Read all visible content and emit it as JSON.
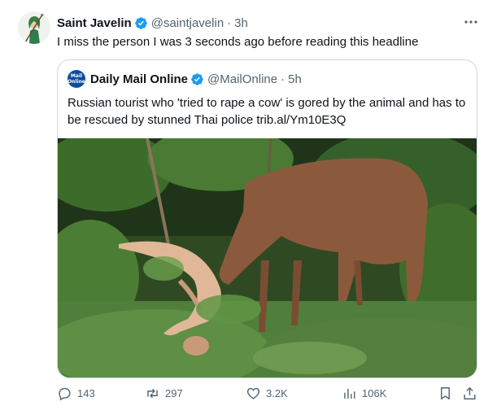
{
  "tweet": {
    "author_name": "Saint Javelin",
    "handle": "@saintjavelin",
    "separator": "·",
    "time": "3h",
    "text": "I miss the person I was 3 seconds ago before reading this headline"
  },
  "quote": {
    "avatar_text_1": "Mail",
    "avatar_text_2": "Online",
    "author_name": "Daily Mail Online",
    "handle": "@MailOnline",
    "separator": "·",
    "time": "5h",
    "text": "Russian tourist who 'tried to rape a cow' is gored by the animal and has to be rescued by stunned Thai police trib.al/Ym10E3Q"
  },
  "actions": {
    "replies": "143",
    "reposts": "297",
    "likes": "3.2K",
    "views": "106K"
  },
  "icons": [
    "verified-badge-icon",
    "more-options-icon",
    "reply-icon",
    "repost-icon",
    "like-icon",
    "views-icon",
    "bookmark-icon",
    "share-icon"
  ],
  "colors": {
    "verified": "#1d9bf0",
    "text": "#0f1419",
    "secondary_text": "#536471",
    "border": "#cfd9de",
    "mail_brand": "#0c4d9c"
  }
}
